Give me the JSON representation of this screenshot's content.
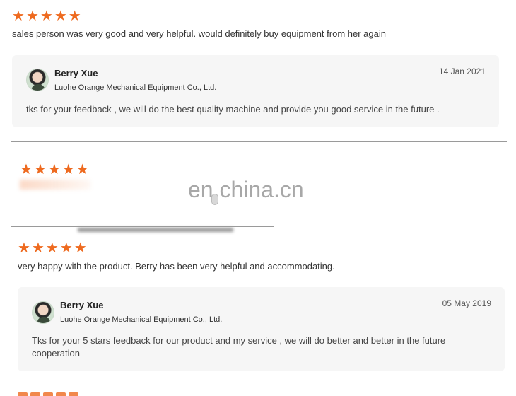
{
  "review1": {
    "stars": [
      "★",
      "★",
      "★",
      "★",
      "★"
    ],
    "text": "sales person was very good and very helpful. would definitely buy equipment from her again",
    "reply": {
      "name": "Berry Xue",
      "company": "Luohe Orange Mechanical Equipment Co., Ltd.",
      "date": "14 Jan 2021",
      "text": "tks for your feedback , we will do the best quality machine and provide you good service in the future ."
    }
  },
  "review2": {
    "stars": [
      "★",
      "★",
      "★",
      "★",
      "★"
    ]
  },
  "watermark": "en.china.cn",
  "review3": {
    "stars": [
      "★",
      "★",
      "★",
      "★",
      "★"
    ],
    "text": "very happy with the product. Berry has been very helpful and accommodating.",
    "reply": {
      "name": "Berry Xue",
      "company": "Luohe Orange Mechanical Equipment Co., Ltd.",
      "date": "05 May 2019",
      "text": "Tks for your 5 stars feedback for our product and my service , we will do better and better in the future cooperation"
    }
  },
  "colors": {
    "star": "#ee6a1f",
    "reply_bg": "#f6f6f6",
    "text": "#333333"
  }
}
